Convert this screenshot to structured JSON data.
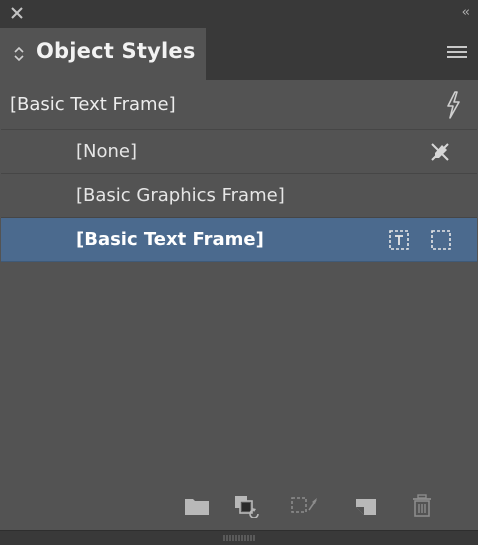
{
  "panel": {
    "title": "Object Styles",
    "current_style": "[Basic Text Frame]"
  },
  "titlebar": {
    "close_icon": "close-icon",
    "collapse_label": "‹‹"
  },
  "styles": [
    {
      "label": "[None]",
      "icons": [
        "clear-overrides-icon"
      ],
      "selected": false
    },
    {
      "label": "[Basic Graphics Frame]",
      "icons": [],
      "selected": false
    },
    {
      "label": "[Basic Text Frame]",
      "icons": [
        "default-text-frame-icon",
        "default-graphic-frame-icon"
      ],
      "selected": true
    }
  ],
  "footer": {
    "buttons": [
      "new-style-group-icon",
      "clear-overrides-icon",
      "clear-non-style-attributes-icon",
      "create-new-style-icon",
      "delete-icon"
    ]
  },
  "colors": {
    "panel_bg": "#535353",
    "chrome_bg": "#393939",
    "selection": "#4b6a8e",
    "icon": "#b8b8b8"
  }
}
